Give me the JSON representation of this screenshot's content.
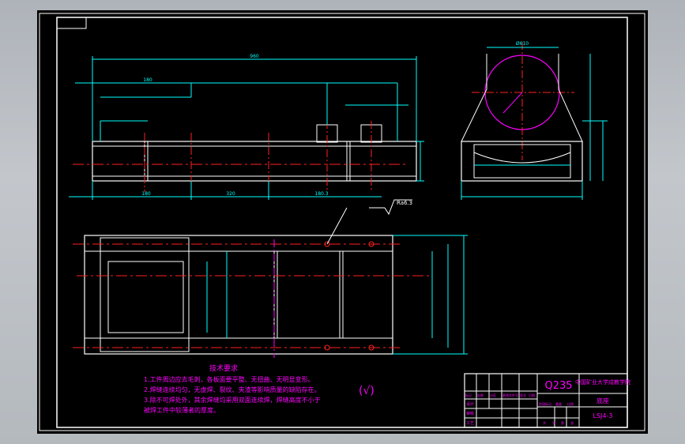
{
  "drawing": {
    "tech_req_title": "技术要求",
    "tech_req_lines": [
      "1.工件周边应去毛刺，各板面要平整、无扭曲、无明显变形。",
      "2.焊缝连续均匀，无虚焊、裂纹、夹渣等影响质量的缺陷存在。",
      "3.除不可焊处外，其余焊缝均采用双面连续焊，焊缝高度不小于",
      "  被焊工件中较薄者的厚度。"
    ],
    "roughness_note": "Ra6.3",
    "surface_mark": "(√)",
    "overall_length": "960",
    "left_seg": "180",
    "middle_seg": "320",
    "right_seg": "180.3",
    "section_mark": "Ø610",
    "title_block": {
      "material": "Q235",
      "school": "中国矿业大学成教学院",
      "part_name": "底座",
      "drawing_no": "LSJ4-3",
      "row_labels": [
        "设计",
        "审核",
        "工艺"
      ],
      "cols": [
        "标记",
        "处数",
        "分区",
        "更改文件号",
        "签名",
        "日期"
      ],
      "stage_labels": [
        "阶段标记",
        "重量",
        "比例"
      ],
      "sheet_labels": [
        "共",
        "张",
        "第",
        "张"
      ]
    }
  },
  "colors": {
    "canvas": "#000000",
    "outline": "#ffffff",
    "dimension": "#00ffff",
    "centerline": "#ff2020",
    "magenta": "#ff00ff",
    "title_text": "#ff00ff"
  }
}
